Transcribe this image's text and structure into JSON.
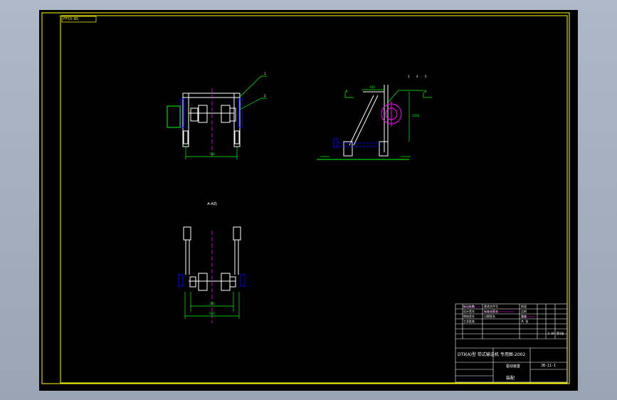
{
  "sheet": {
    "corner_tag": "FF53-BS",
    "colors": {
      "frame": "#ffff00",
      "drawing": "#ffffff",
      "dimension": "#00ff00",
      "center": "#ff00ff",
      "hidden": "#0000ff",
      "background": "#000000"
    }
  },
  "views": {
    "top_view": {
      "dim_width": "760"
    },
    "side_view": {
      "section_left": "A",
      "section_right": "A",
      "dim_top": "350",
      "leaders": [
        "3",
        "4",
        "5"
      ],
      "dim_right": "1250"
    },
    "front_view": {
      "leaders": [
        "1",
        "2"
      ],
      "title": "A-A向",
      "dim_inner": "280",
      "dim_outer": "560"
    }
  },
  "title_block": {
    "left_rows": [
      "标记处数",
      "设计签名",
      "审核签名",
      "工艺批准"
    ],
    "mid_rows": [
      "更改文件号",
      "标准化签名",
      "日期签名"
    ],
    "right_rows": [
      "阶段",
      "比例",
      "重量",
      "共 张"
    ],
    "company": "DTⅡ(A)型 带式输送机 专用图-2002",
    "drawing_name": "驱动装置",
    "drawing_no": "JB-11-1",
    "material": "装配",
    "scale": "1:10",
    "sheet_info": "第1张"
  }
}
